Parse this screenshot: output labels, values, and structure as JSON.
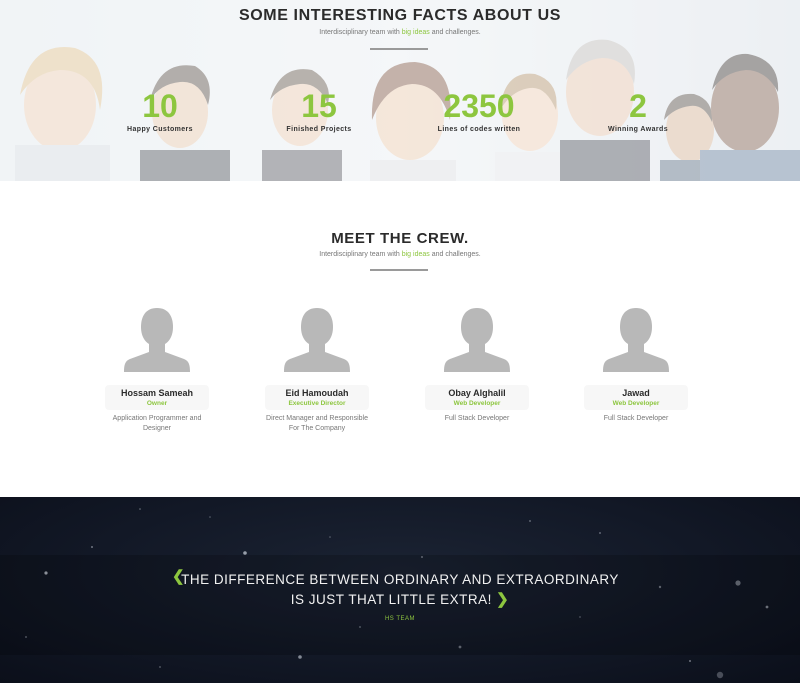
{
  "colors": {
    "accent": "#8dc63f",
    "dark_bg": "#121826",
    "text_dark": "#2b2b2b",
    "text_muted": "#777777"
  },
  "facts": {
    "title": "SOME INTERESTING FACTS ABOUT US",
    "subtitle_pre": "Interdisciplinary team with ",
    "subtitle_accent": "big ideas",
    "subtitle_post": " and challenges.",
    "items": [
      {
        "number": "10",
        "label": "Happy Customers"
      },
      {
        "number": "15",
        "label": "Finished Projects"
      },
      {
        "number": "2350",
        "label": "Lines of codes written"
      },
      {
        "number": "2",
        "label": "Winning Awards"
      }
    ]
  },
  "crew": {
    "title": "MEET THE CREW.",
    "subtitle_pre": "Interdisciplinary team with ",
    "subtitle_accent": "big ideas",
    "subtitle_post": " and challenges.",
    "members": [
      {
        "name": "Hossam Sameah",
        "role": "Owner",
        "description": "Application Programmer and Designer",
        "avatar_icon": "user-silhouette-icon"
      },
      {
        "name": "Eid Hamoudah",
        "role": "Executive Director",
        "description": "Direct Manager and Responsible For The Company",
        "avatar_icon": "user-silhouette-icon"
      },
      {
        "name": "Obay Alghalil",
        "role": "Web Developer",
        "description": "Full Stack Developer",
        "avatar_icon": "user-silhouette-icon"
      },
      {
        "name": "Jawad",
        "role": "Web Developer",
        "description": "Full Stack Developer",
        "avatar_icon": "user-silhouette-icon"
      }
    ]
  },
  "quote": {
    "line1": "THE DIFFERENCE BETWEEN ORDINARY AND EXTRAORDINARY",
    "line2": "IS JUST THAT LITTLE EXTRA!",
    "author": "HS TEAM",
    "prev_icon": "chevron-left-icon",
    "next_icon": "chevron-right-icon",
    "prev_glyph": "❮",
    "next_glyph": "❯"
  }
}
